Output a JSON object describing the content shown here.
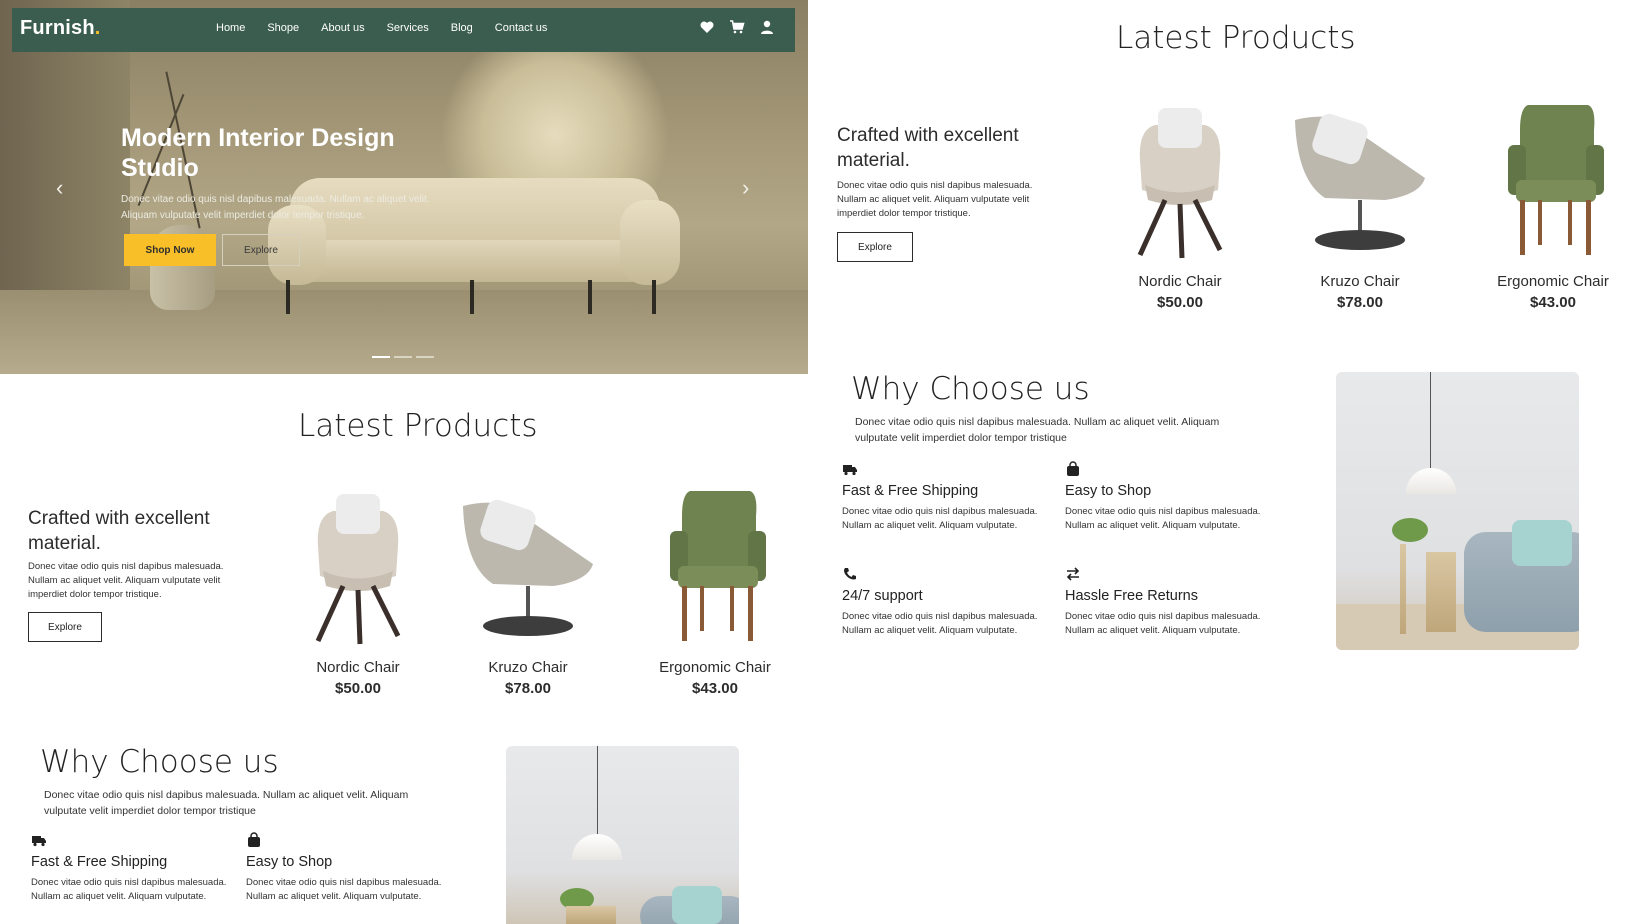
{
  "brand": {
    "name": "Furnish",
    "dot": "."
  },
  "nav": {
    "links": [
      "Home",
      "Shope",
      "About us",
      "Services",
      "Blog",
      "Contact us"
    ],
    "icons": [
      "heart-icon",
      "cart-icon",
      "user-icon"
    ]
  },
  "hero": {
    "title": "Modern Interior Design Studio",
    "description": "Donec vitae odio quis nisl dapibus malesuada. Nullam ac aliquet velit. Aliquam vulputate velit imperdiet dolor tempor tristique.",
    "shop_label": "Shop Now",
    "explore_label": "Explore",
    "prev_arrow": "‹",
    "next_arrow": "›",
    "slides": 3,
    "active_slide": 1
  },
  "products": {
    "section_title": "Latest Products",
    "crafted_title": "Crafted with excellent material.",
    "crafted_desc": "Donec vitae odio quis nisl dapibus malesuada. Nullam ac aliquet velit. Aliquam vulputate velit imperdiet dolor tempor tristique.",
    "explore_label": "Explore",
    "items": [
      {
        "name": "Nordic Chair",
        "price": "$50.00",
        "color": "#d8d0c4"
      },
      {
        "name": "Kruzo Chair",
        "price": "$78.00",
        "color": "#bcb8ae"
      },
      {
        "name": "Ergonomic Chair",
        "price": "$43.00",
        "color": "#6f8350"
      }
    ]
  },
  "why": {
    "title": "Why Choose us",
    "description": "Donec vitae odio quis nisl dapibus malesuada. Nullam ac aliquet velit. Aliquam vulputate velit imperdiet dolor tempor tristique",
    "features": [
      {
        "icon": "truck-icon",
        "title": "Fast & Free Shipping",
        "text": "Donec vitae odio quis nisl dapibus malesuada. Nullam ac aliquet velit. Aliquam vulputate."
      },
      {
        "icon": "bag-icon",
        "title": "Easy to Shop",
        "text": "Donec vitae odio quis nisl dapibus malesuada. Nullam ac aliquet velit. Aliquam vulputate."
      },
      {
        "icon": "phone-icon",
        "title": "24/7 support",
        "text": "Donec vitae odio quis nisl dapibus malesuada. Nullam ac aliquet velit. Aliquam vulputate."
      },
      {
        "icon": "return-icon",
        "title": "Hassle Free Returns",
        "text": "Donec vitae odio quis nisl dapibus malesuada. Nullam ac aliquet velit. Aliquam vulputate."
      }
    ]
  },
  "colors": {
    "nav": "#3b5d50",
    "accent": "#f9bf29"
  }
}
